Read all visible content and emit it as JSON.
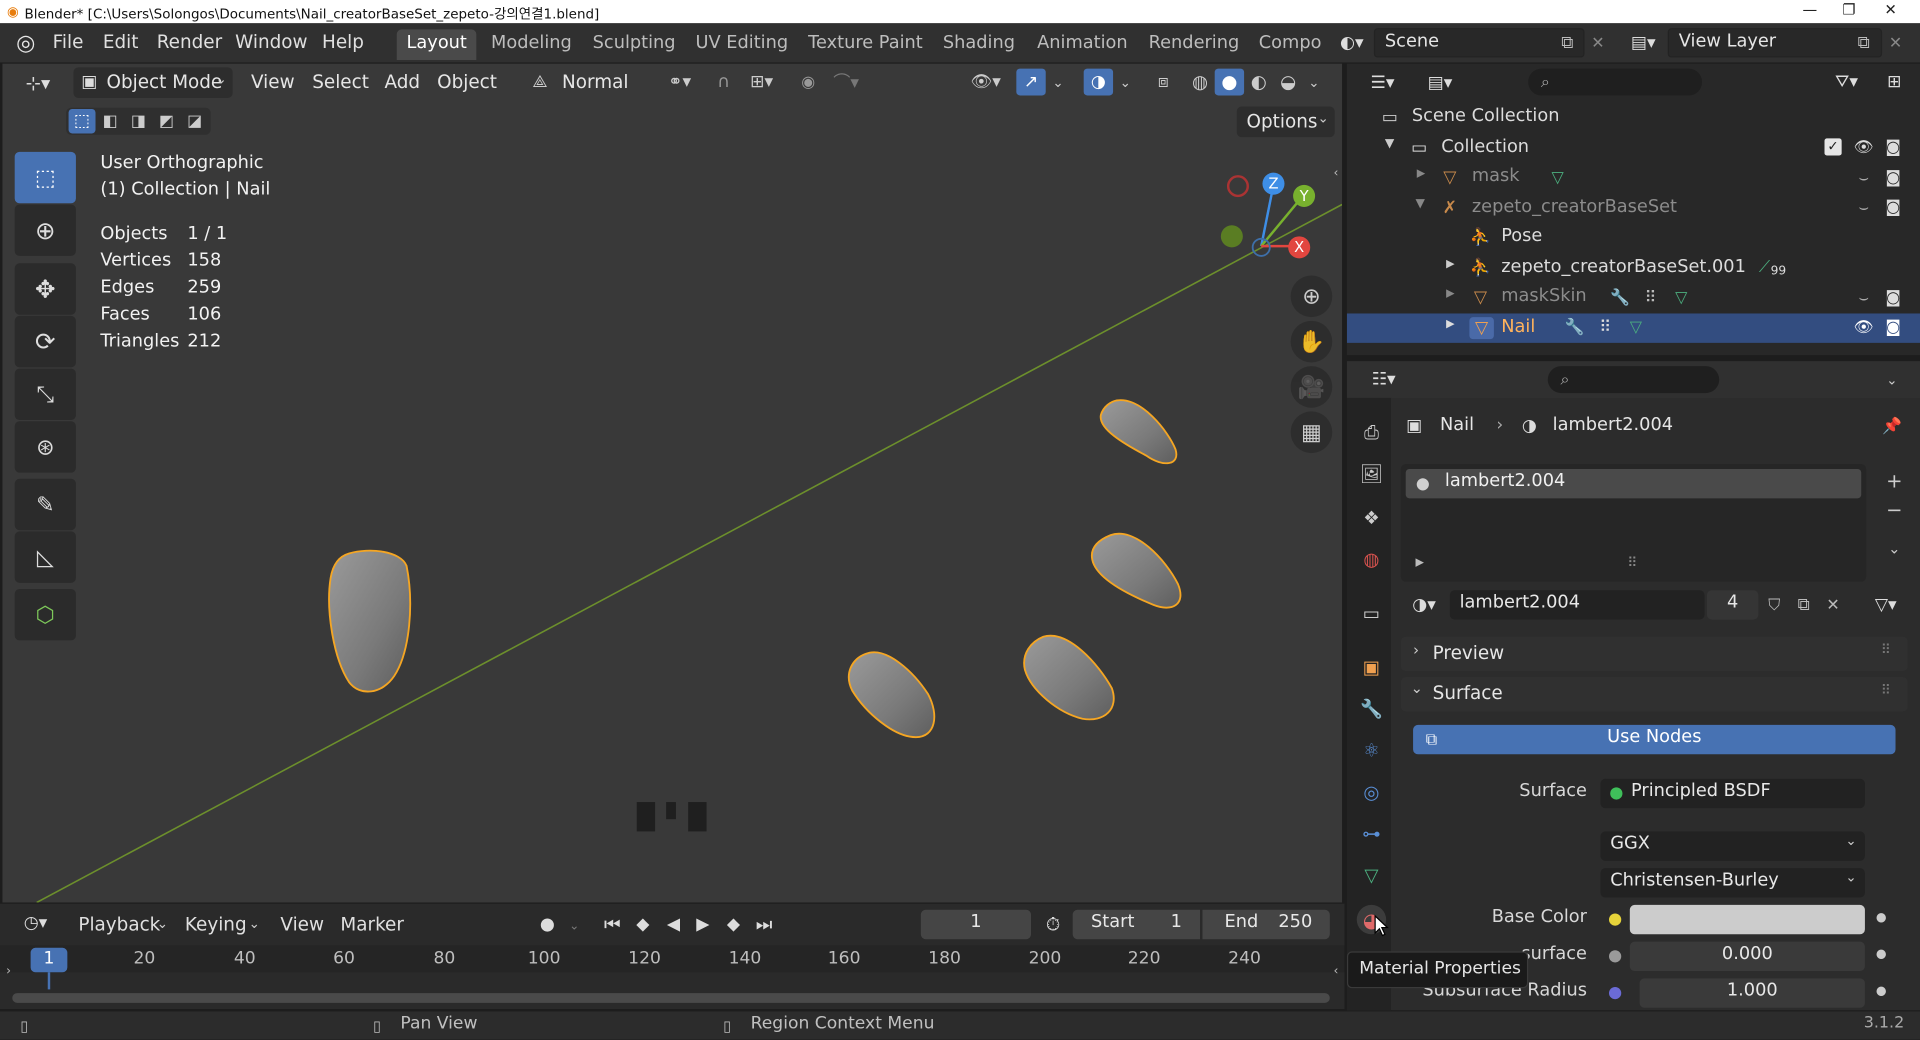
{
  "window": {
    "title": "Blender* [C:\\Users\\Solongos\\Documents\\Nail_creatorBaseSet_zepeto-강의연결1.blend]",
    "minimize": "—",
    "maximize": "❐",
    "close": "✕"
  },
  "topbar": {
    "menus": [
      "File",
      "Edit",
      "Render",
      "Window",
      "Help"
    ],
    "workspaces": [
      "Layout",
      "Modeling",
      "Sculpting",
      "UV Editing",
      "Texture Paint",
      "Shading",
      "Animation",
      "Rendering",
      "Compo"
    ],
    "active_workspace": "Layout",
    "scene_label": "Scene",
    "view_layer_label": "View Layer"
  },
  "viewport": {
    "mode": "Object Mode",
    "menus": [
      "View",
      "Select",
      "Add",
      "Object"
    ],
    "orientation": "Normal",
    "options_label": "Options",
    "overlay_title": "User Orthographic",
    "overlay_subtitle": "(1) Collection | Nail",
    "stats": [
      {
        "label": "Objects",
        "value": "1 / 1"
      },
      {
        "label": "Vertices",
        "value": "158"
      },
      {
        "label": "Edges",
        "value": "259"
      },
      {
        "label": "Faces",
        "value": "106"
      },
      {
        "label": "Triangles",
        "value": "212"
      }
    ],
    "gizmo_axes": [
      "Z",
      "Y",
      "X"
    ]
  },
  "timeline": {
    "menus": [
      "Playback",
      "Keying",
      "View",
      "Marker"
    ],
    "current_frame": "1",
    "start_label": "Start",
    "start_value": "1",
    "end_label": "End",
    "end_value": "250",
    "playhead_label": "1",
    "ticks": [
      "20",
      "40",
      "60",
      "80",
      "100",
      "120",
      "140",
      "160",
      "180",
      "200",
      "220",
      "240"
    ]
  },
  "outliner": {
    "root": "Scene Collection",
    "rows": [
      {
        "label": "Collection"
      },
      {
        "label": "mask"
      },
      {
        "label": "zepeto_creatorBaseSet"
      },
      {
        "label": "Pose"
      },
      {
        "label": "zepeto_creatorBaseSet.001",
        "badge": "99"
      },
      {
        "label": "maskSkin"
      },
      {
        "label": "Nail"
      }
    ]
  },
  "properties": {
    "breadcrumb_object": "Nail",
    "breadcrumb_material": "lambert2.004",
    "slot_name": "lambert2.004",
    "material_name": "lambert2.004",
    "user_count": "4",
    "panel_preview": "Preview",
    "panel_surface": "Surface",
    "use_nodes_label": "Use Nodes",
    "surface_label": "Surface",
    "surface_value": "Principled BSDF",
    "distribution": "GGX",
    "subsurface_method": "Christensen-Burley",
    "base_color_label": "Base Color",
    "subsurface_label": "surface",
    "subsurface_value": "0.000",
    "subsurface_radius_label": "Subsurface Radius",
    "subsurface_radius_value": "1.000",
    "tooltip": "Material Properties"
  },
  "statusbar": {
    "pan_view": "Pan View",
    "region_context_menu": "Region Context Menu",
    "version": "3.1.2"
  },
  "colors": {
    "accent": "#4772b3",
    "selection_outline": "#f5a623",
    "axis_x": "#e2463f",
    "axis_y": "#78b12e",
    "axis_z": "#3e8ee6",
    "viewport_bg": "#393939",
    "x_axis_line": "#6c8f2c"
  }
}
